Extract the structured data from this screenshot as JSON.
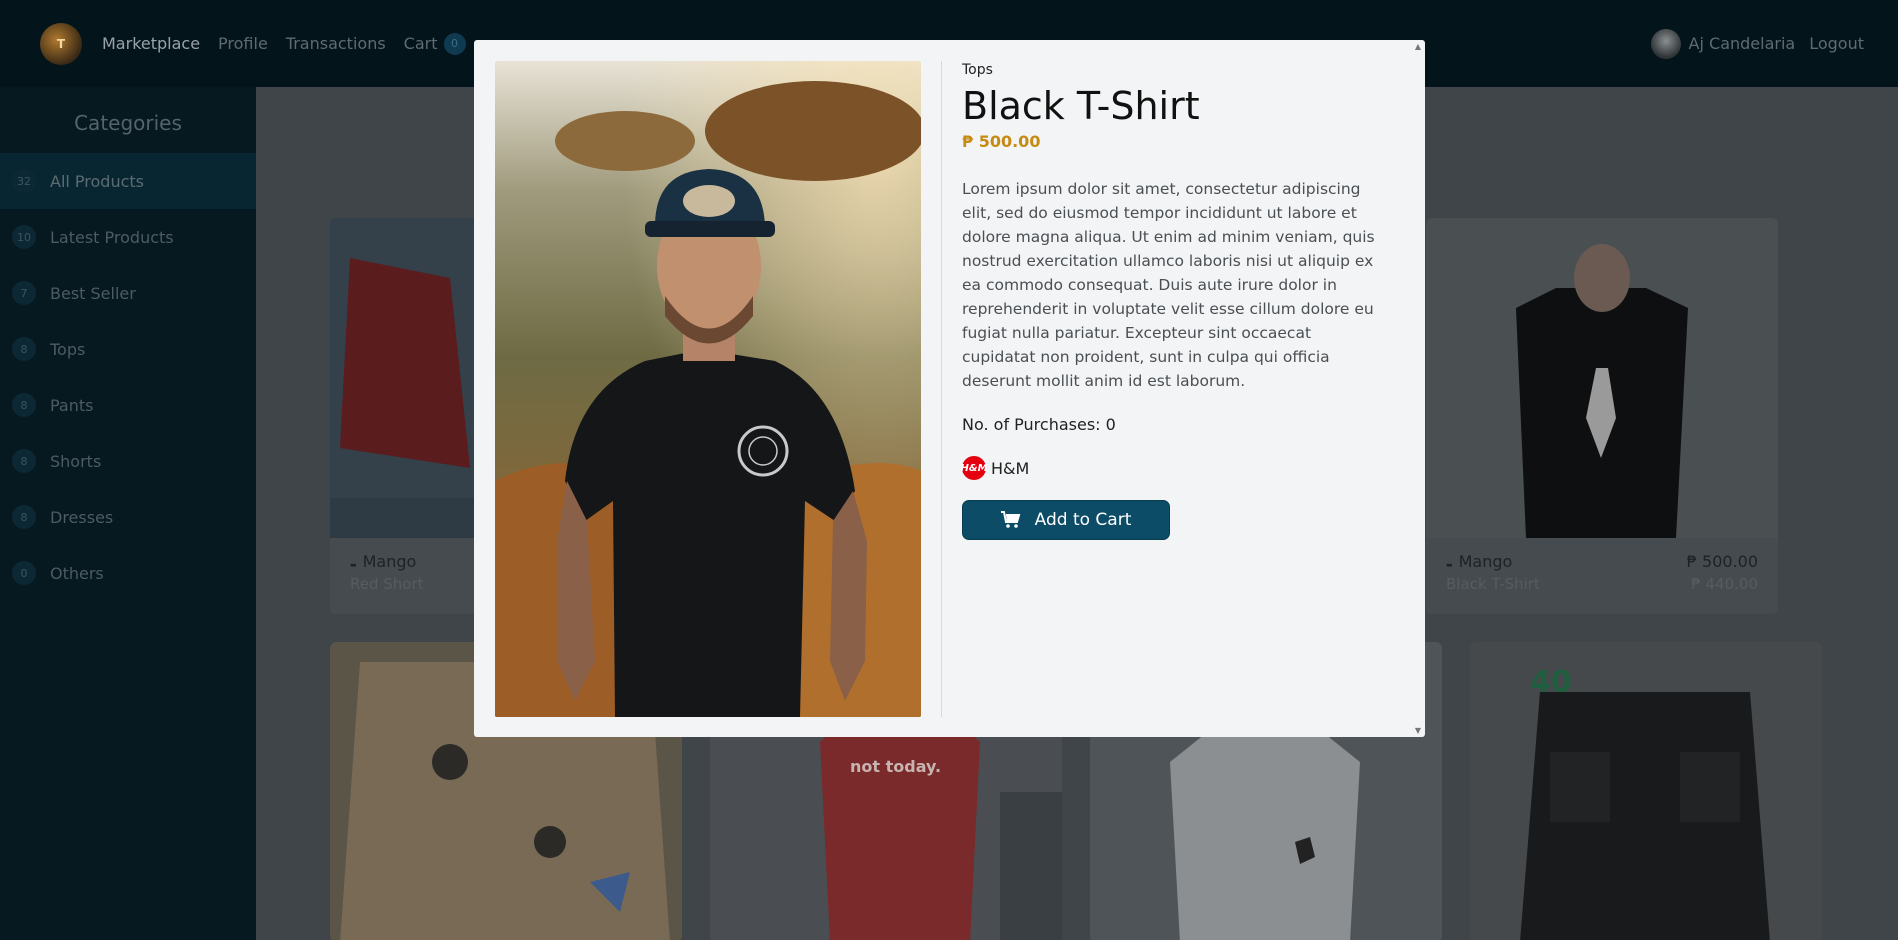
{
  "navbar": {
    "logo_text": "T",
    "links": [
      {
        "label": "Marketplace"
      },
      {
        "label": "Profile"
      },
      {
        "label": "Transactions"
      },
      {
        "label": "Cart"
      }
    ],
    "cart_count": "0",
    "user_name": "Aj Candelaria",
    "logout_label": "Logout"
  },
  "sidebar": {
    "title": "Categories",
    "items": [
      {
        "count": "32",
        "label": "All Products"
      },
      {
        "count": "10",
        "label": "Latest Products"
      },
      {
        "count": "7",
        "label": "Best Seller"
      },
      {
        "count": "8",
        "label": "Tops"
      },
      {
        "count": "8",
        "label": "Pants"
      },
      {
        "count": "8",
        "label": "Shorts"
      },
      {
        "count": "8",
        "label": "Dresses"
      },
      {
        "count": "0",
        "label": "Others"
      }
    ]
  },
  "cards": [
    {
      "brand": "Mango",
      "name": "Red Short",
      "price": "",
      "old_price": ""
    },
    {
      "brand": "Mango",
      "name": "Black T-Shirt",
      "price": "₱ 500.00",
      "old_price": "₱ 440.00"
    }
  ],
  "modal": {
    "category": "Tops",
    "title": "Black T-Shirt",
    "price": "₱ 500.00",
    "description": "Lorem ipsum dolor sit amet, consectetur adipiscing elit, sed do eiusmod tempor incididunt ut labore et dolore magna aliqua. Ut enim ad minim veniam, quis nostrud exercitation ullamco laboris nisi ut aliquip ex ea commodo consequat. Duis aute irure dolor in reprehenderit in voluptate velit esse cillum dolore eu fugiat nulla pariatur. Excepteur sint occaecat cupidatat non proident, sunt in culpa qui officia deserunt mollit anim id est laborum.",
    "purchases": "No. of Purchases: 0",
    "brand_logo_text": "H&M",
    "brand_name": "H&M",
    "add_to_cart_label": "Add to Cart"
  },
  "colors": {
    "accent": "#0d4c67",
    "price": "#c58b13"
  }
}
